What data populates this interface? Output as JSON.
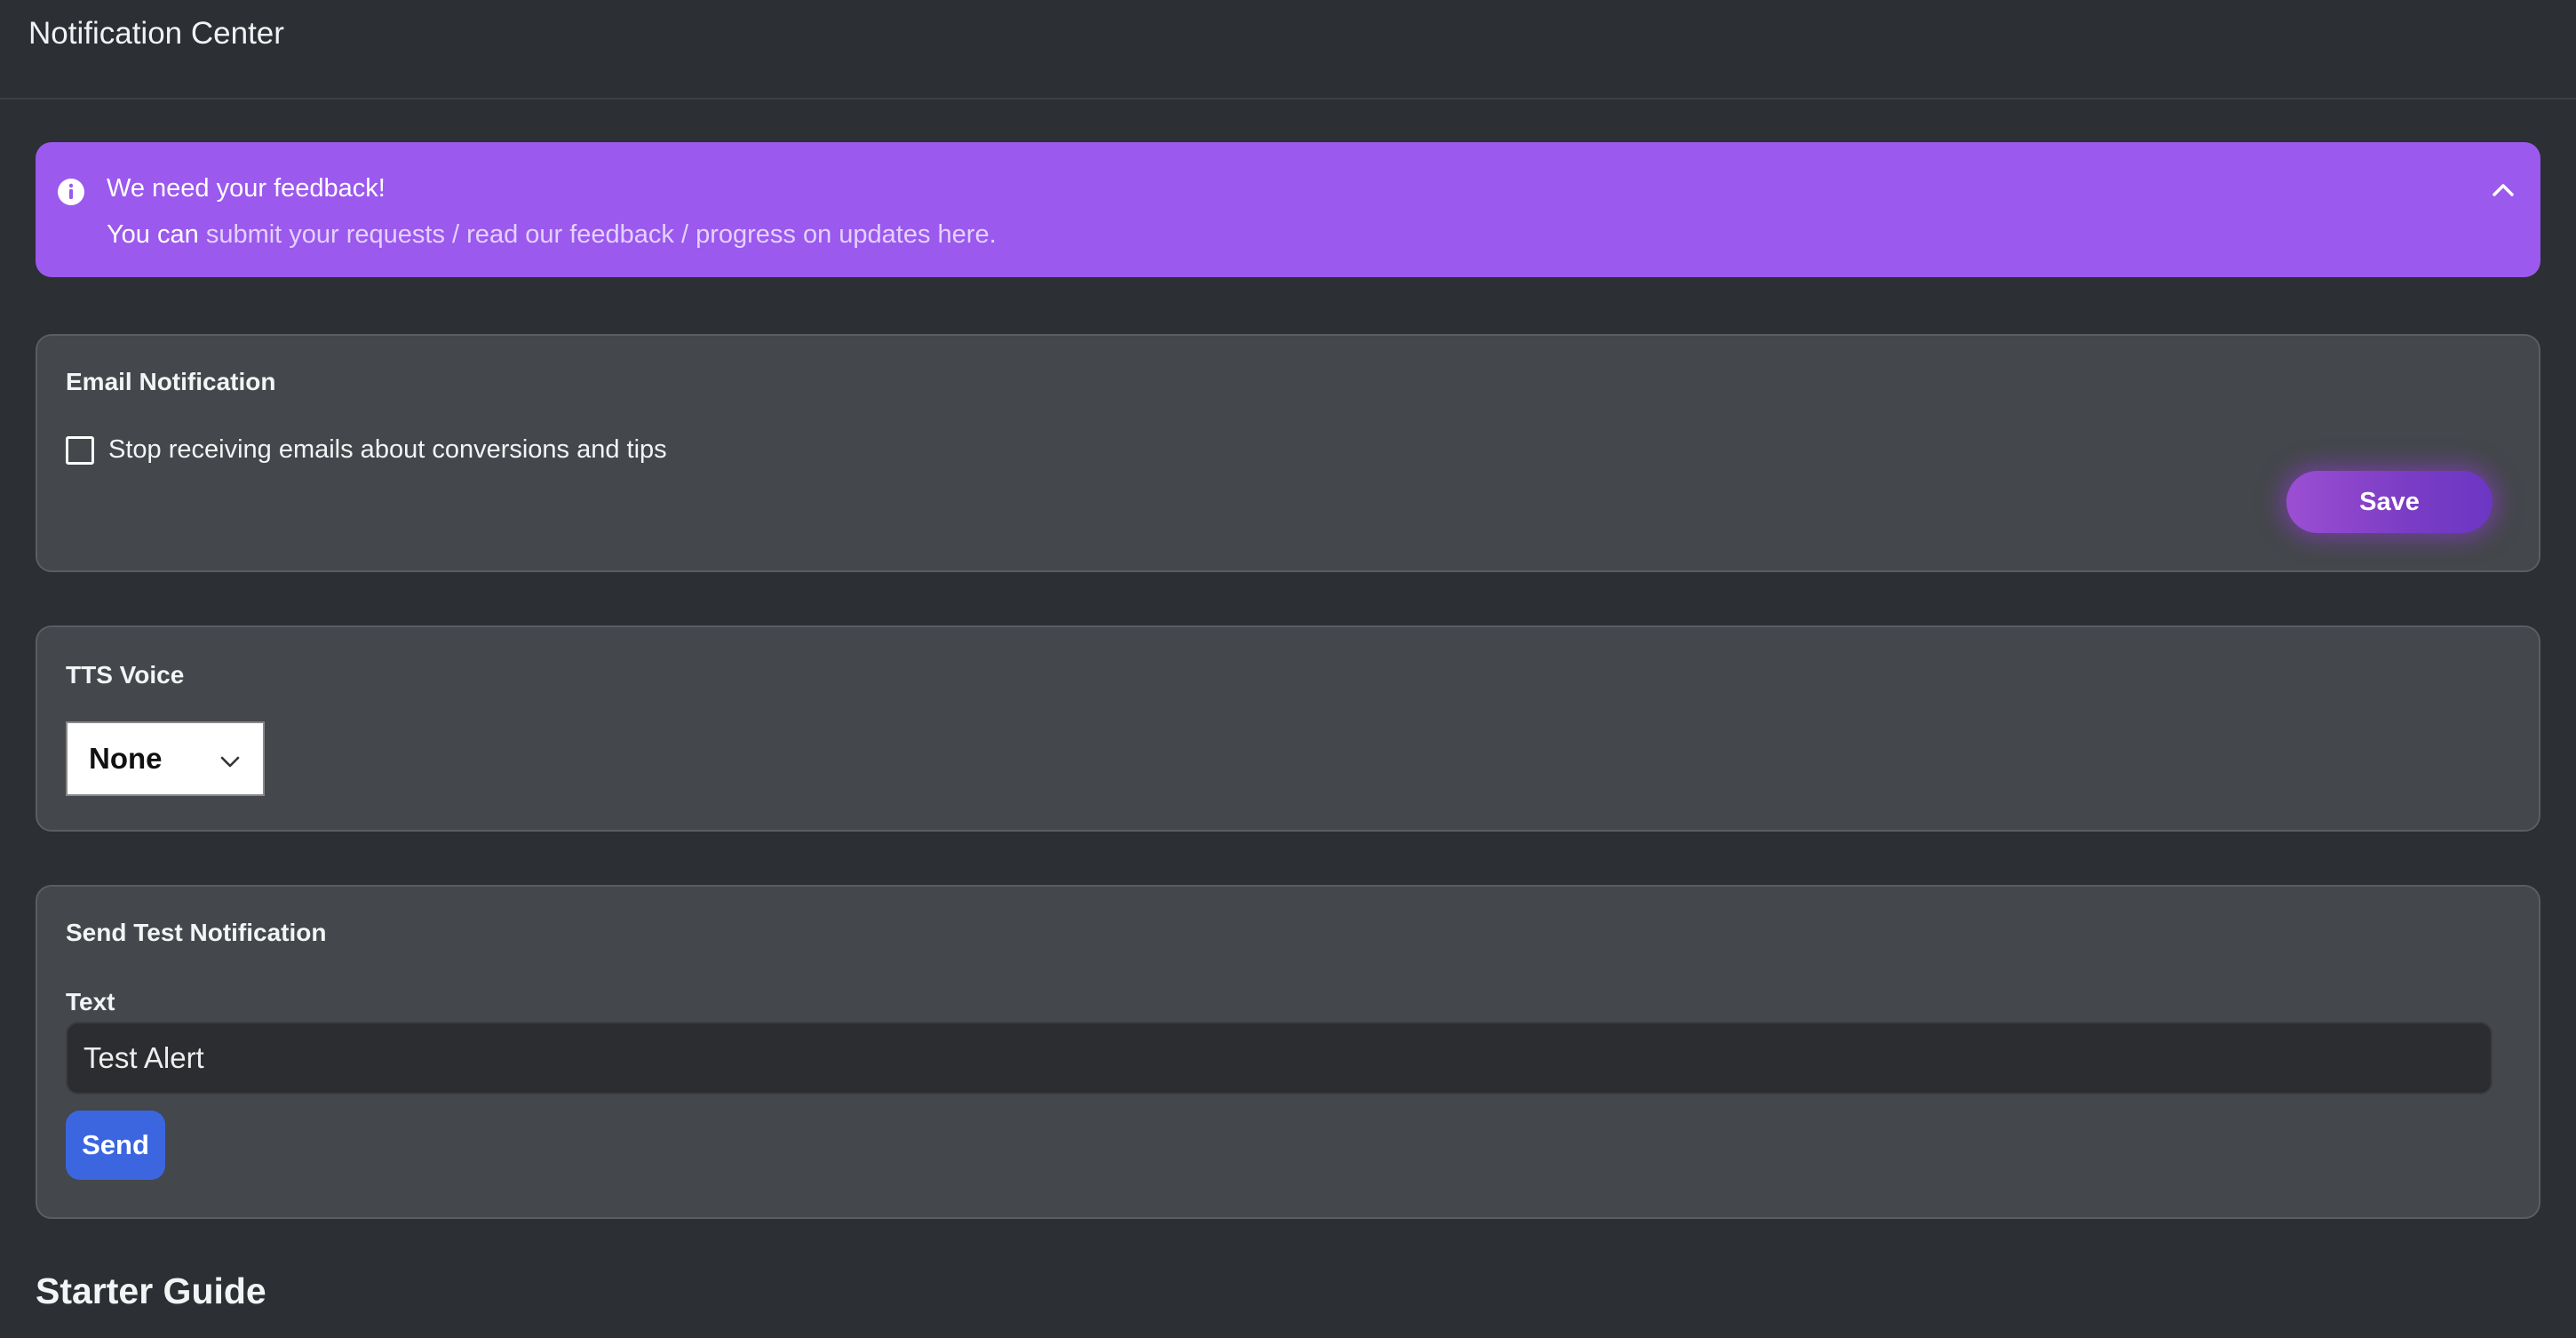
{
  "header": {
    "title": "Notification Center"
  },
  "banner": {
    "title": "We need your feedback!",
    "prefix": "You can ",
    "link_text": "submit your requests / read our feedback / progress on updates here.",
    "icons": {
      "info": "info-icon",
      "collapse": "chevron-up-icon"
    },
    "color": "#9b59ee"
  },
  "email_card": {
    "title": "Email Notification",
    "checkbox_label": "Stop receiving emails about conversions and tips",
    "checked": false,
    "save_label": "Save"
  },
  "tts_card": {
    "title": "TTS Voice",
    "selected": "None"
  },
  "test_card": {
    "title": "Send Test Notification",
    "field_label": "Text",
    "input_value": "Test Alert",
    "send_label": "Send",
    "send_color": "#3b66e0"
  },
  "starter": {
    "title": "Starter Guide"
  }
}
